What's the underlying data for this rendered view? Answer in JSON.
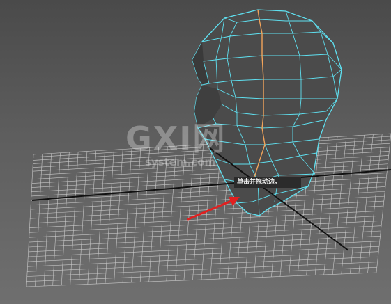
{
  "viewport": {
    "name": "3D perspective viewport",
    "tooltip_text": "单击并拖动边。"
  },
  "watermark": {
    "main": "GXI网",
    "sub": "system.com"
  },
  "colors": {
    "wire": "#5fe0f0",
    "selected_edge": "#f2a45a",
    "grid_line": "#c9c9c9",
    "axis_line": "#111111",
    "arrow": "#e02020",
    "mesh_fill": "#4a4a4a"
  }
}
